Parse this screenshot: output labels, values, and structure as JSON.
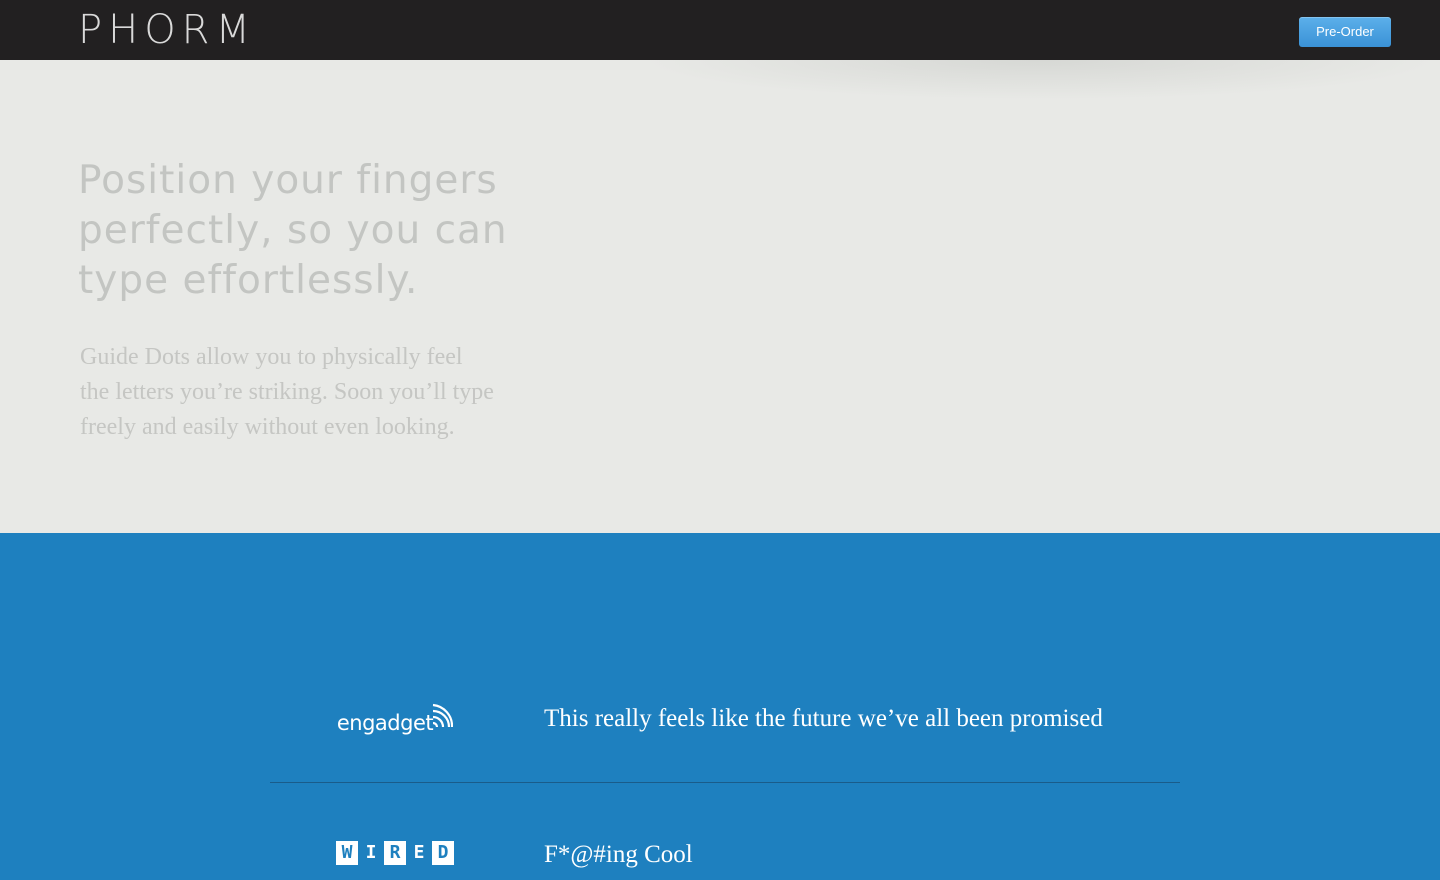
{
  "header": {
    "brand": "PHORM",
    "preorder_label": "Pre-Order"
  },
  "hero": {
    "headline_lines": [
      "Position your fingers",
      "perfectly, so you can",
      "type effortlessly."
    ],
    "subcopy_lines": [
      "Guide Dots allow you to physically feel",
      "the letters you’re striking. Soon you’ll type",
      "freely and easily without even looking."
    ]
  },
  "press": {
    "items": [
      {
        "source": "engadget",
        "logo_icon": "engadget-logo",
        "quote": "This really feels like the future we’ve all been promised"
      },
      {
        "source": "WIRED",
        "logo_icon": "wired-logo",
        "quote": "F*@#ing Cool"
      }
    ]
  },
  "colors": {
    "header_bg": "#222021",
    "hero_bg": "#e8e9e6",
    "press_bg": "#1e80bf",
    "button": "#4aa3e3"
  }
}
